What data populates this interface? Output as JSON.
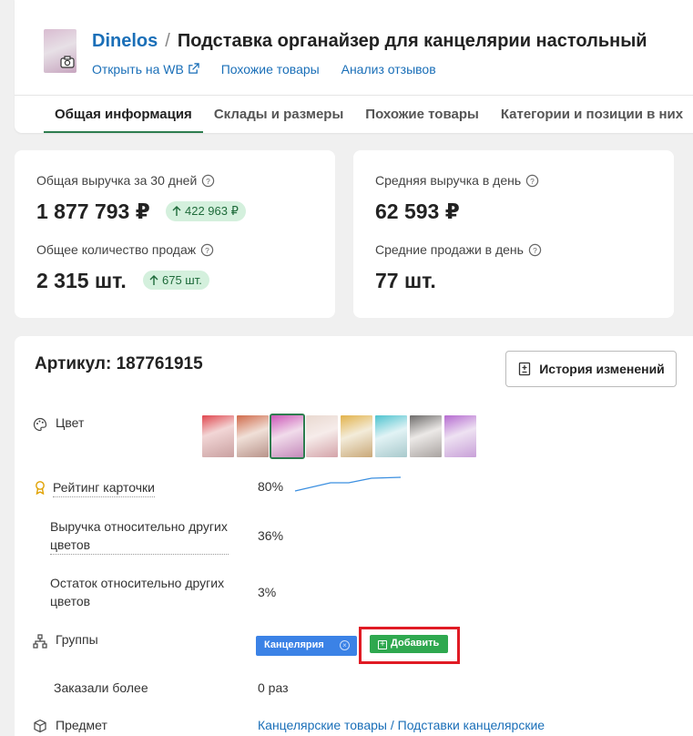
{
  "header": {
    "brand": "Dinelos",
    "separator": "/",
    "title": "Подставка органайзер для канцелярии настольный",
    "links": {
      "open_wb": "Открыть на WB",
      "similar": "Похожие товары",
      "reviews": "Анализ отзывов"
    },
    "tabs": [
      "Общая информация",
      "Склады и размеры",
      "Похожие товары",
      "Категории и позиции в них"
    ]
  },
  "stats": {
    "revenue_30_label": "Общая выручка за 30 дней",
    "revenue_30_value": "1 877 793 ₽",
    "revenue_30_delta": "422 963 ₽",
    "sales_total_label": "Общее количество продаж",
    "sales_total_value": "2 315 шт.",
    "sales_total_delta": "675 шт.",
    "avg_revenue_label": "Средняя выручка в день",
    "avg_revenue_value": "62 593 ₽",
    "avg_sales_label": "Средние продажи в день",
    "avg_sales_value": "77 шт."
  },
  "details": {
    "article_label": "Артикул: 187761915",
    "history_button": "История изменений",
    "color_label": "Цвет",
    "rating_label": "Рейтинг карточки",
    "rating_value": "80%",
    "revenue_rel_label": "Выручка относительно других цветов",
    "revenue_rel_value": "36%",
    "stock_rel_label": "Остаток относительно других цветов",
    "stock_rel_value": "3%",
    "groups_label": "Группы",
    "group_tag": "Канцелярия",
    "add_button": "Добавить",
    "ordered_label": "Заказали более",
    "ordered_value": "0 раз",
    "subject_label": "Предмет",
    "subject_value": "Канцелярские товары / Подставки канцелярские"
  },
  "colors": {
    "accent": "#1a6fb8",
    "green": "#2e7d4f",
    "delta_bg": "#d4f0dd",
    "tag_blue": "#3b82e6",
    "tag_green": "#2fa84f",
    "highlight": "#e01b24"
  },
  "swatches": [
    "#d9a3a8",
    "#cfa69a",
    "#d987c7",
    "#e6d9d5",
    "#d8c08f",
    "#a9dbe0",
    "#c8c2be",
    "#c9a0d6"
  ]
}
